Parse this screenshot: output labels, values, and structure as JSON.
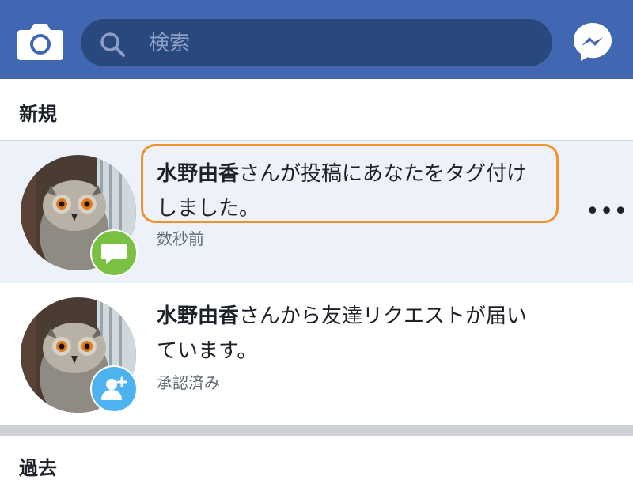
{
  "header": {
    "search_placeholder": "検索",
    "brand_color": "#4267b2",
    "search_bg": "#29487d"
  },
  "sections": {
    "new_title": "新規",
    "past_title": "過去"
  },
  "notifications": [
    {
      "name": "水野由香",
      "text": "さんが投稿にあなたをタグ付けしました。",
      "line1_rest": "さんが投稿にあなたをタグ付け",
      "line2": "しました。",
      "time": "数秒前",
      "badge": "comment-icon",
      "badge_color": "#7ac143",
      "highlighted": true,
      "more": "•••"
    },
    {
      "name": "水野由香",
      "text": "さんから友達リクエストが届いています。",
      "line1_rest": "さんから友達リクエストが届い",
      "line2": "ています。",
      "time": "承認済み",
      "badge": "add-friend-icon",
      "badge_color": "#4cb3f0",
      "highlighted": false
    }
  ]
}
